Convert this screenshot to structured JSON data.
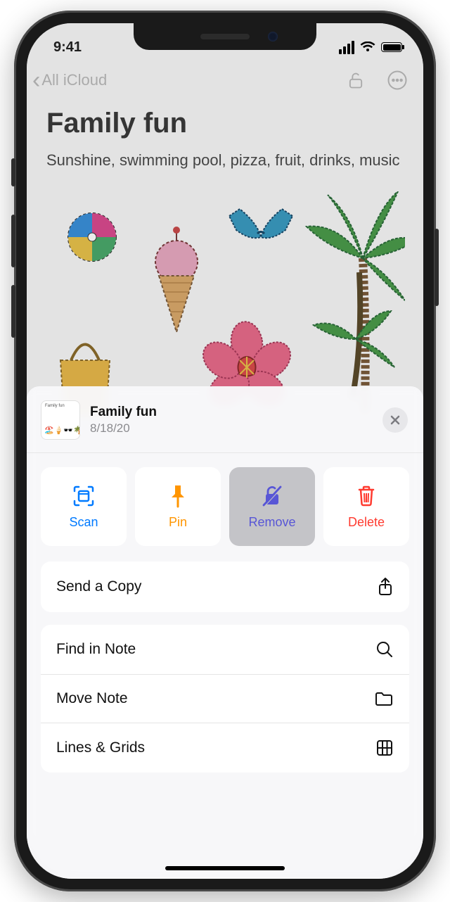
{
  "status": {
    "time": "9:41"
  },
  "nav": {
    "back_label": "All iCloud"
  },
  "note": {
    "title": "Family fun",
    "body": "Sunshine, swimming pool, pizza, fruit, drinks, music"
  },
  "sheet": {
    "title": "Family fun",
    "date": "8/18/20",
    "tiles": {
      "scan": "Scan",
      "pin": "Pin",
      "remove": "Remove",
      "delete": "Delete"
    },
    "rows": {
      "send_copy": "Send a Copy",
      "find": "Find in Note",
      "move": "Move Note",
      "lines": "Lines & Grids"
    }
  }
}
